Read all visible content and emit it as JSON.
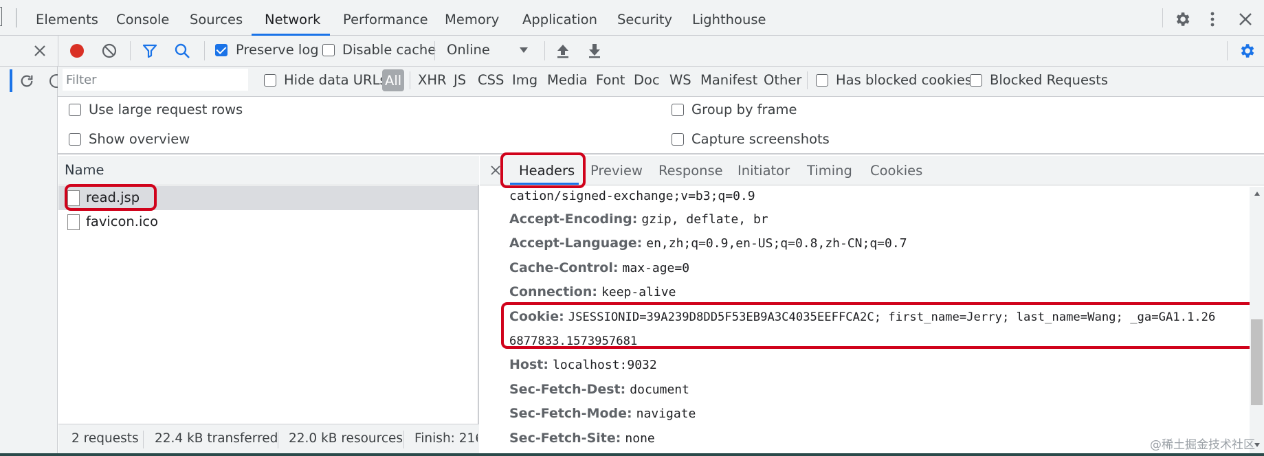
{
  "tabs": [
    "Elements",
    "Console",
    "Sources",
    "Network",
    "Performance",
    "Memory",
    "Application",
    "Security",
    "Lighthouse"
  ],
  "active_tab": "Network",
  "toolbar": {
    "preserve_log": "Preserve log",
    "disable_cache": "Disable cache",
    "throttle": "Online"
  },
  "filterbar": {
    "placeholder": "Filter",
    "hide_data_urls": "Hide data URLs",
    "types": [
      "All",
      "XHR",
      "JS",
      "CSS",
      "Img",
      "Media",
      "Font",
      "Doc",
      "WS",
      "Manifest",
      "Other"
    ],
    "has_blocked_cookies": "Has blocked cookies",
    "blocked_requests": "Blocked Requests"
  },
  "settings": {
    "large_rows": "Use large request rows",
    "show_overview": "Show overview",
    "group_by_frame": "Group by frame",
    "capture_screenshots": "Capture screenshots"
  },
  "name_pane": {
    "header": "Name",
    "files": [
      "read.jsp",
      "favicon.ico"
    ]
  },
  "status": {
    "requests": "2 requests",
    "transferred": "22.4 kB transferred",
    "resources": "22.0 kB resources",
    "finish": "Finish: 216"
  },
  "detail_tabs": [
    "Headers",
    "Preview",
    "Response",
    "Initiator",
    "Timing",
    "Cookies"
  ],
  "headers": {
    "accept_tail": "cation/signed-exchange;v=b3;q=0.9",
    "rows": [
      {
        "k": "Accept-Encoding:",
        "v": "gzip, deflate, br"
      },
      {
        "k": "Accept-Language:",
        "v": "en,zh;q=0.9,en-US;q=0.8,zh-CN;q=0.7"
      },
      {
        "k": "Cache-Control:",
        "v": "max-age=0"
      },
      {
        "k": "Connection:",
        "v": "keep-alive"
      }
    ],
    "cookie_key": "Cookie:",
    "cookie_line1": "JSESSIONID=39A239D8DD5F53EB9A3C4035EEFFCA2C; first_name=Jerry; last_name=Wang; _ga=GA1.1.26",
    "cookie_line2": "6877833.1573957681",
    "rows2": [
      {
        "k": "Host:",
        "v": "localhost:9032"
      },
      {
        "k": "Sec-Fetch-Dest:",
        "v": "document"
      },
      {
        "k": "Sec-Fetch-Mode:",
        "v": "navigate"
      },
      {
        "k": "Sec-Fetch-Site:",
        "v": "none"
      }
    ]
  },
  "watermark": "@稀土掘金技术社区",
  "colors": {
    "accent": "#1a73e8",
    "record": "#d93025",
    "highlight": "#d0021b"
  }
}
